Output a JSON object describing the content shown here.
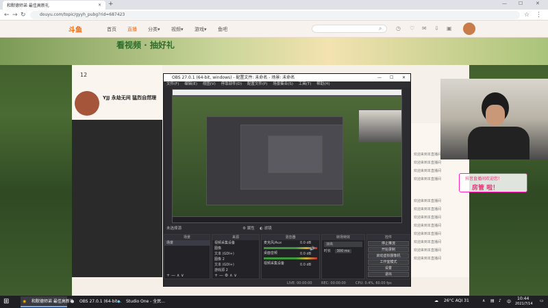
{
  "browser": {
    "tab_title": "和默德师弟 最佳高新礼",
    "url": "douyu.com/topic/gyyh_pubg?rid=687423"
  },
  "douyu": {
    "logo": "斗鱼",
    "nav": [
      "首页",
      "直播",
      "分类▾",
      "视频▾",
      "游戏▾",
      "鱼吧"
    ],
    "active_nav": "直播",
    "banner_text": "看视频 · 抽好礼",
    "room_count": "12",
    "room_title": "YJJ 永劫无间 猛烈自然理",
    "chat_lines": [
      "欢迎来到本直播间",
      "欢迎来到本直播间",
      "欢迎来到本直播间",
      "欢迎来到本直播间",
      "欢迎来到本直播间",
      "欢迎来到本直播间",
      "欢迎来到本直播间",
      "欢迎来到本直播间",
      "欢迎来到本直播间",
      "欢迎来到本直播间",
      "欢迎来到本直播间",
      "欢迎来到本直播间"
    ],
    "caption_top": "抖音直播间欢迎您！",
    "caption_main": "房管    啦！"
  },
  "obs": {
    "title": "OBS 27.0.1 (64-bit, windows) - 配置文件: 未命名 - 场景: 未命名",
    "menu": [
      "文件(F)",
      "编辑(E)",
      "视图(V)",
      "停靠部件(D)",
      "配置文件(P)",
      "场景集合(S)",
      "工具(T)",
      "帮助(H)"
    ],
    "source_status": "未选择源",
    "prop_btn": "属性",
    "filter_btn": "滤镜",
    "scenes_title": "场景",
    "scene_item": "场景",
    "sources_title": "来源",
    "sources": [
      "视频采集设备",
      "图像",
      "文本 (GDI+)",
      "图像 2",
      "文本 (GDI+)",
      "游戏源 2"
    ],
    "mixer_title": "混音器",
    "mixer_tracks": [
      {
        "name": "麦克风/Aux",
        "db": "0.0 dB"
      },
      {
        "name": "桌面音频",
        "db": "0.0 dB"
      },
      {
        "name": "视频采集设备",
        "db": "0.0 dB"
      }
    ],
    "transition_title": "转场特效",
    "transition_value": "淡出",
    "duration_label": "时长",
    "duration_value": "300 ms",
    "controls_title": "控件",
    "controls": [
      "停止推流",
      "开始录制",
      "启动虚拟摄像机",
      "工作室模式",
      "设置",
      "退出"
    ],
    "status_live": "LIVE: 00:00:00",
    "status_rec": "REC: 00:00:00",
    "status_cpu": "CPU: 0.4%, 60.00 fps"
  },
  "taskbar": {
    "items": [
      "",
      "OBS 27.0.1 (64-bit...",
      "Studio One - 全民..."
    ],
    "weather": "26°C AQI 31",
    "ime": "中",
    "time": "10:44",
    "date": "2021/7/14"
  }
}
